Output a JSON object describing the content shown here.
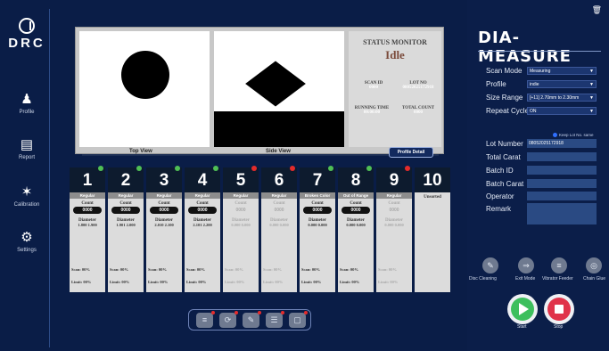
{
  "sidebar": {
    "logo": "DRC",
    "items": [
      {
        "label": "Profile",
        "icon": "user-icon"
      },
      {
        "label": "Report",
        "icon": "chart-icon"
      },
      {
        "label": "Calibration",
        "icon": "tools-icon"
      },
      {
        "label": "Settings",
        "icon": "gear-icon"
      }
    ]
  },
  "viewer": {
    "top_view_label": "Top View",
    "side_view_label": "Side View",
    "status_title": "STATUS MONITOR",
    "status_value": "Idle",
    "scan_id_label": "SCAN ID",
    "scan_id_value": "0000",
    "lot_no_label": "LOT NO",
    "lot_no_value": "08052025172918",
    "running_time_label": "RUNNING TIME",
    "running_time_value": "00:00:00",
    "total_count_label": "TOTAL COUNT",
    "total_count_value": "0000",
    "profile_detail_button": "Profile Detail"
  },
  "cards": [
    {
      "num": "1",
      "label": "Regular",
      "count": "0000",
      "diameter": "1.800 1.900",
      "scan": "Scan: 00%",
      "limit": "Limit: 00%",
      "dot": "#4fbf55",
      "active": true
    },
    {
      "num": "2",
      "label": "Regular",
      "count": "0000",
      "diameter": "1.901 2.000",
      "scan": "Scan: 00%",
      "limit": "Limit: 00%",
      "dot": "#4fbf55",
      "active": true
    },
    {
      "num": "3",
      "label": "Regular",
      "count": "0000",
      "diameter": "2.010 2.100",
      "scan": "Scan: 00%",
      "limit": "Limit: 00%",
      "dot": "#4fbf55",
      "active": true
    },
    {
      "num": "4",
      "label": "Regular",
      "count": "0000",
      "diameter": "2.101 2.200",
      "scan": "Scan: 00%",
      "limit": "Limit: 00%",
      "dot": "#4fbf55",
      "active": true
    },
    {
      "num": "5",
      "label": "Regular",
      "count": "0000",
      "diameter": "0.000 0.000",
      "scan": "Scan: 00%",
      "limit": "Limit: 00%",
      "dot": "#e52b2b",
      "active": false
    },
    {
      "num": "6",
      "label": "Regular",
      "count": "0000",
      "diameter": "0.000 0.000",
      "scan": "Scan: 00%",
      "limit": "Limit: 00%",
      "dot": "#e52b2b",
      "active": false
    },
    {
      "num": "7",
      "label": "Broken Color",
      "count": "0000",
      "diameter": "0.000 0.000",
      "scan": "Scan: 00%",
      "limit": "Limit: 00%",
      "dot": "#4fbf55",
      "active": true
    },
    {
      "num": "8",
      "label": "Out of Range",
      "count": "0000",
      "diameter": "0.000 0.000",
      "scan": "Scan: 00%",
      "limit": "Limit: 00%",
      "dot": "#4fbf55",
      "active": true
    },
    {
      "num": "9",
      "label": "Regular",
      "count": "0000",
      "diameter": "0.000 0.000",
      "scan": "Scan: 00%",
      "limit": "Limit: 00%",
      "dot": "#e52b2b",
      "active": false
    }
  ],
  "card10": {
    "num": "10",
    "label": "Unsorted"
  },
  "count_label": "Count",
  "diameter_label": "Diameter",
  "toolbar": {
    "icons": [
      "vibrator-icon",
      "rotate-icon",
      "brush-icon",
      "feeder-icon",
      "camera-icon"
    ]
  },
  "right": {
    "brand": "DIA-MEASURE",
    "scan_mode_label": "Scan Mode",
    "scan_mode_value": "Measuring",
    "profile_label": "Profile",
    "profile_value": "indie",
    "size_range_label": "Size Range",
    "size_range_value": "[+11] 2.70mm to 2.30mm",
    "repeat_cycle_label": "Repeat Cycle",
    "repeat_cycle_value": "ON",
    "keep_lot_label": "Keep Lot No. same",
    "lot_number_label": "Lot Number",
    "lot_number_value": "08052025172918",
    "total_carat_label": "Total Carat",
    "batch_id_label": "Batch ID",
    "batch_carat_label": "Batch Carat",
    "operator_label": "Operator",
    "remark_label": "Remark",
    "action_buttons": [
      {
        "label": "Disc Cleaning",
        "icon": "disc-cleaning-icon"
      },
      {
        "label": "Exit Mode",
        "icon": "exit-icon"
      },
      {
        "label": "Vibrator Feeder",
        "icon": "vibrator-icon"
      },
      {
        "label": "Chain Glue",
        "icon": "chain-icon"
      }
    ],
    "start_label": "Start",
    "stop_label": "Stop"
  }
}
